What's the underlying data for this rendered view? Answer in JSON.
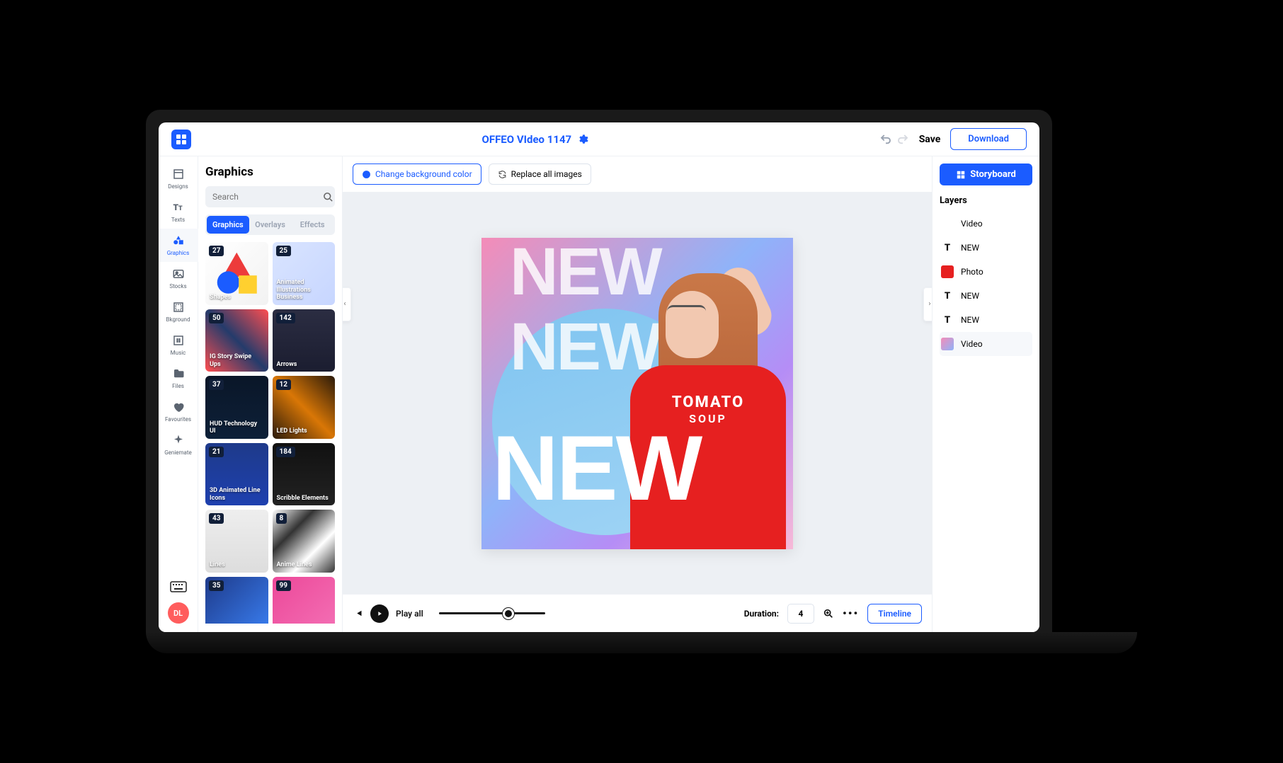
{
  "project_title": "OFFEO VIdeo 1147",
  "top": {
    "save": "Save",
    "download": "Download"
  },
  "nav": [
    {
      "icon": "designs",
      "label": "Designs"
    },
    {
      "icon": "texts",
      "label": "Texts"
    },
    {
      "icon": "graphics",
      "label": "Graphics",
      "active": true
    },
    {
      "icon": "stocks",
      "label": "Stocks"
    },
    {
      "icon": "bkground",
      "label": "Bkground"
    },
    {
      "icon": "music",
      "label": "Music"
    },
    {
      "icon": "files",
      "label": "Files"
    },
    {
      "icon": "favourites",
      "label": "Favourites"
    },
    {
      "icon": "geniemate",
      "label": "Geniemate"
    }
  ],
  "avatar": "DL",
  "panel": {
    "title": "Graphics",
    "search_placeholder": "Search",
    "tabs": [
      "Graphics",
      "Overlays",
      "Effects"
    ],
    "active_tab": 0
  },
  "cards": [
    {
      "count": "27",
      "label": "Shapes",
      "bg": "linear-gradient(135deg,#fff,#f2f2f2)",
      "deco": "shapes"
    },
    {
      "count": "25",
      "label": "Animated Illustrations Business",
      "bg": "linear-gradient(135deg,#d9e4ff,#c7d6ff)"
    },
    {
      "count": "50",
      "label": "IG Story Swipe Ups",
      "bg": "linear-gradient(45deg,#ff4e50,#243b6b,#ff4e50)"
    },
    {
      "count": "142",
      "label": "Arrows",
      "bg": "linear-gradient(#2b2d42,#1b1d30)"
    },
    {
      "count": "37",
      "label": "HUD Technology UI",
      "bg": "linear-gradient(#0a1628,#0d2038)"
    },
    {
      "count": "12",
      "label": "LED Lights",
      "bg": "linear-gradient(45deg,#2a1a0a,#d97706,#2a1a0a)"
    },
    {
      "count": "21",
      "label": "3D Animated Line Icons",
      "bg": "linear-gradient(#1e3a8a,#1e40af)"
    },
    {
      "count": "184",
      "label": "Scribble Elements",
      "bg": "linear-gradient(#111,#222)"
    },
    {
      "count": "43",
      "label": "Lines",
      "bg": "linear-gradient(#eee,#ddd)"
    },
    {
      "count": "8",
      "label": "Anime Lines",
      "bg": "linear-gradient(135deg,#fff,#333,#fff,#333)"
    },
    {
      "count": "35",
      "label": "",
      "bg": "linear-gradient(135deg,#1e3a8a,#3b82f6)"
    },
    {
      "count": "99",
      "label": "",
      "bg": "linear-gradient(135deg,#ec4899,#f472b6)"
    }
  ],
  "canvas": {
    "change_bg": "Change background color",
    "replace_images": "Replace all images",
    "text1": "NEW",
    "text2": "NEW",
    "text3": "NEW",
    "shirt_text": "TOMATO",
    "shirt_text2": "SOUP"
  },
  "playback": {
    "play_all": "Play all",
    "duration_label": "Duration:",
    "duration_value": "4",
    "timeline": "Timeline"
  },
  "right": {
    "storyboard": "Storyboard",
    "layers_title": "Layers",
    "layers": [
      {
        "type": "blank",
        "name": "Video"
      },
      {
        "type": "text",
        "name": "NEW"
      },
      {
        "type": "photo",
        "name": "Photo"
      },
      {
        "type": "text",
        "name": "NEW"
      },
      {
        "type": "text",
        "name": "NEW"
      },
      {
        "type": "video",
        "name": "Video",
        "selected": true
      }
    ]
  }
}
